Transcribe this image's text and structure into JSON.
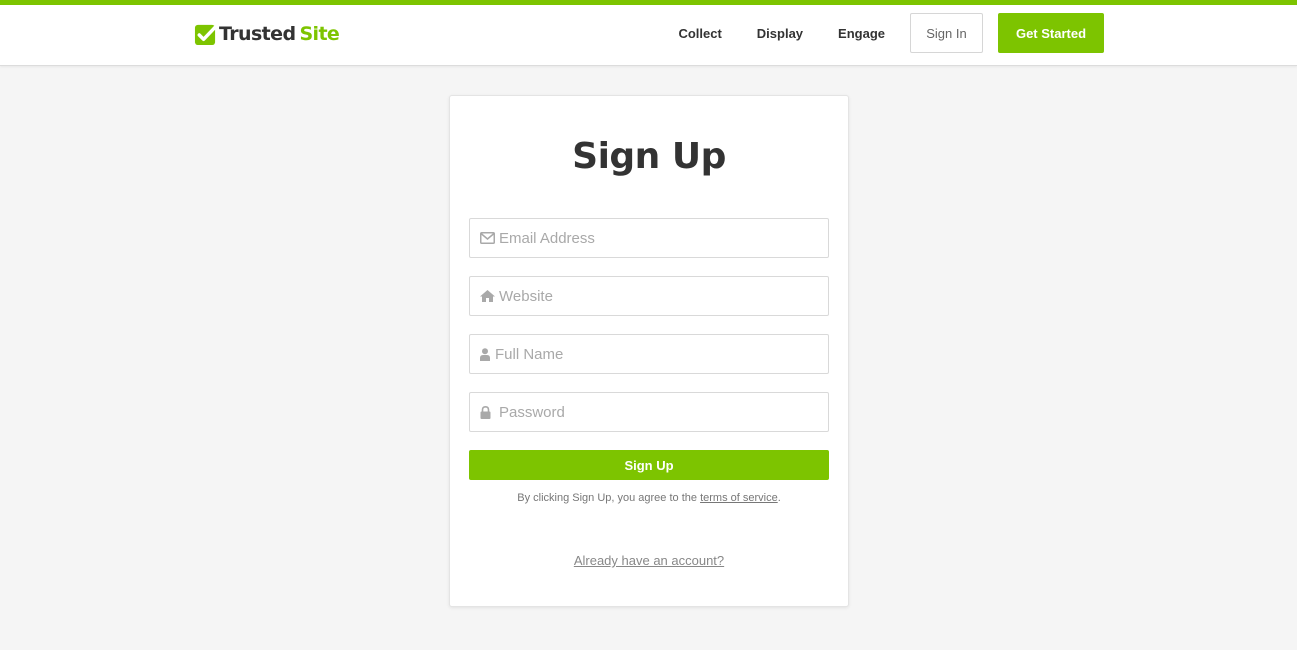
{
  "brand": {
    "name_part1": "Trusted",
    "name_part2": "Site",
    "accent_color": "#7dc400",
    "logo_icon": "checkmark-shield-icon"
  },
  "nav": {
    "links": [
      "Collect",
      "Display",
      "Engage"
    ],
    "sign_in": "Sign In",
    "get_started": "Get Started"
  },
  "form": {
    "title": "Sign Up",
    "fields": [
      {
        "icon": "envelope-icon",
        "placeholder": "Email Address",
        "value": ""
      },
      {
        "icon": "home-icon",
        "placeholder": "Website",
        "value": ""
      },
      {
        "icon": "user-icon",
        "placeholder": "Full Name",
        "value": ""
      },
      {
        "icon": "lock-icon",
        "placeholder": "Password",
        "value": ""
      }
    ],
    "submit_label": "Sign Up",
    "terms_prefix": "By clicking Sign Up, you agree to the ",
    "terms_link": "terms of service",
    "terms_suffix": ".",
    "already_account": "Already have an account?"
  }
}
